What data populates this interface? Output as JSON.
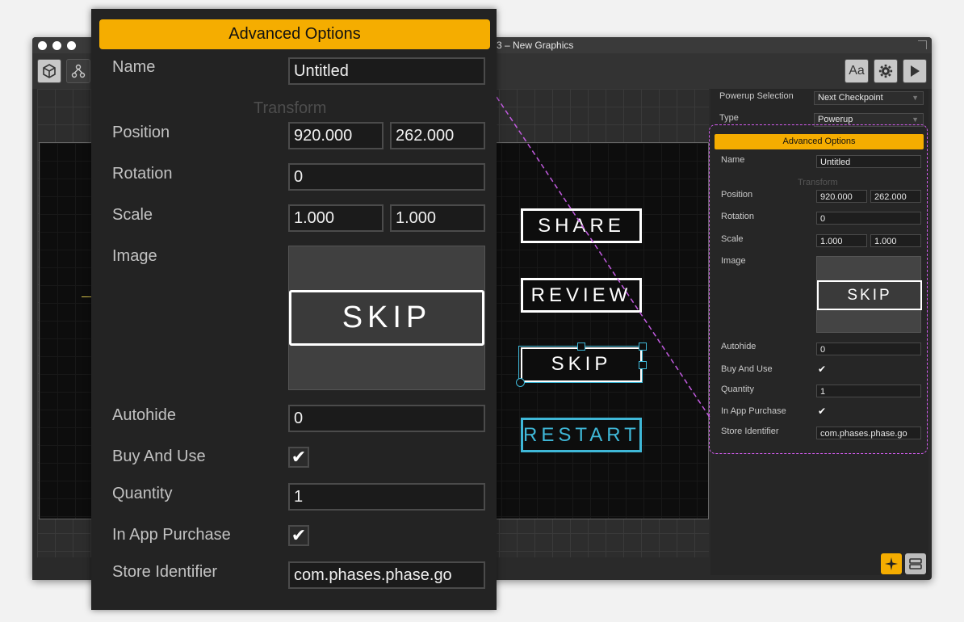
{
  "window": {
    "title": "3 – New Graphics"
  },
  "toolbar": {
    "font_label": "Aa"
  },
  "canvas": {
    "buttons": [
      "SHARE",
      "REVIEW",
      "SKIP",
      "RESTART"
    ]
  },
  "panel": {
    "powerup_selection_label": "Powerup Selection",
    "powerup_selection_value": "Next Checkpoint",
    "type_label": "Type",
    "type_value": "Powerup",
    "header": "Advanced Options",
    "name_label": "Name",
    "name_value": "Untitled",
    "transform_label": "Transform",
    "position_label": "Position",
    "position_x": "920.000",
    "position_y": "262.000",
    "rotation_label": "Rotation",
    "rotation_value": "0",
    "scale_label": "Scale",
    "scale_x": "1.000",
    "scale_y": "1.000",
    "image_label": "Image",
    "image_text": "SKIP",
    "autohide_label": "Autohide",
    "autohide_value": "0",
    "buy_and_use_label": "Buy And Use",
    "quantity_label": "Quantity",
    "quantity_value": "1",
    "in_app_purchase_label": "In App Purchase",
    "store_identifier_label": "Store Identifier",
    "store_identifier_value": "com.phases.phase.go"
  },
  "colors": {
    "accent": "#f5ad00",
    "dashed_highlight": "#d35cf0",
    "selection": "#3fb8d8"
  }
}
